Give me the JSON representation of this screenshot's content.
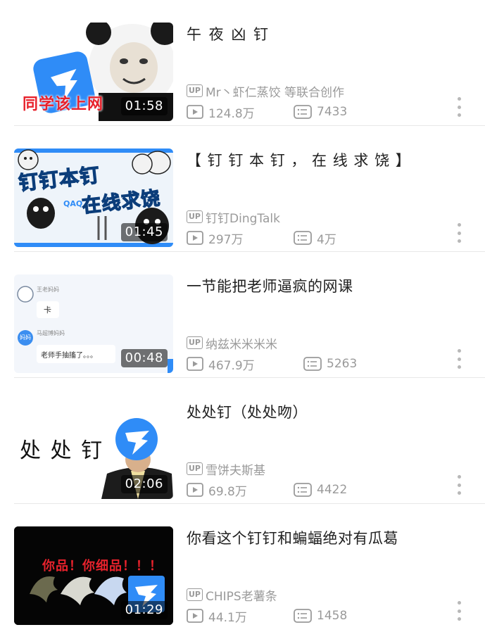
{
  "videos": [
    {
      "title": "午 夜 凶 钉",
      "uploader": "Mr丶虾仁蒸饺 等联合创作",
      "up_tag": "UP",
      "views": "124.8万",
      "danmaku": "7433",
      "duration": "01:58",
      "thumb_caption": "同学该上网"
    },
    {
      "title": "【 钉 钉 本 钉 ， 在 线 求 饶 】",
      "uploader": "钉钉DingTalk",
      "up_tag": "UP",
      "views": "297万",
      "danmaku": "4万",
      "duration": "01:45",
      "thumb_caption_1": "钉钉本钉",
      "thumb_caption_2": "在线求饶",
      "thumb_caption_3": "QAQ"
    },
    {
      "title": "一节能把老师逼疯的网课",
      "uploader": "纳兹米米米米",
      "up_tag": "UP",
      "views": "467.9万",
      "danmaku": "5263",
      "duration": "00:48",
      "chat_name_1": "王老妈妈",
      "chat_msg_1": "卡",
      "chat_name_2": "马超博妈妈",
      "chat_avatar_2": "妈妈",
      "chat_msg_2": "老师手抽搐了。。。"
    },
    {
      "title": "处处钉（处处吻）",
      "uploader": "雪饼夫斯基",
      "up_tag": "UP",
      "views": "69.8万",
      "danmaku": "4422",
      "duration": "02:06",
      "thumb_caption": "处 处 钉"
    },
    {
      "title": "你看这个钉钉和蝙蝠绝对有瓜葛",
      "uploader": "CHIPS老薯条",
      "up_tag": "UP",
      "views": "44.1万",
      "danmaku": "1458",
      "duration": "01:29",
      "thumb_caption": "你品！你细品！！！"
    }
  ],
  "colors": {
    "accent_blue": "#2f8cf7",
    "caption_red": "#e8222c",
    "meta_gray": "#9a9a9a"
  }
}
